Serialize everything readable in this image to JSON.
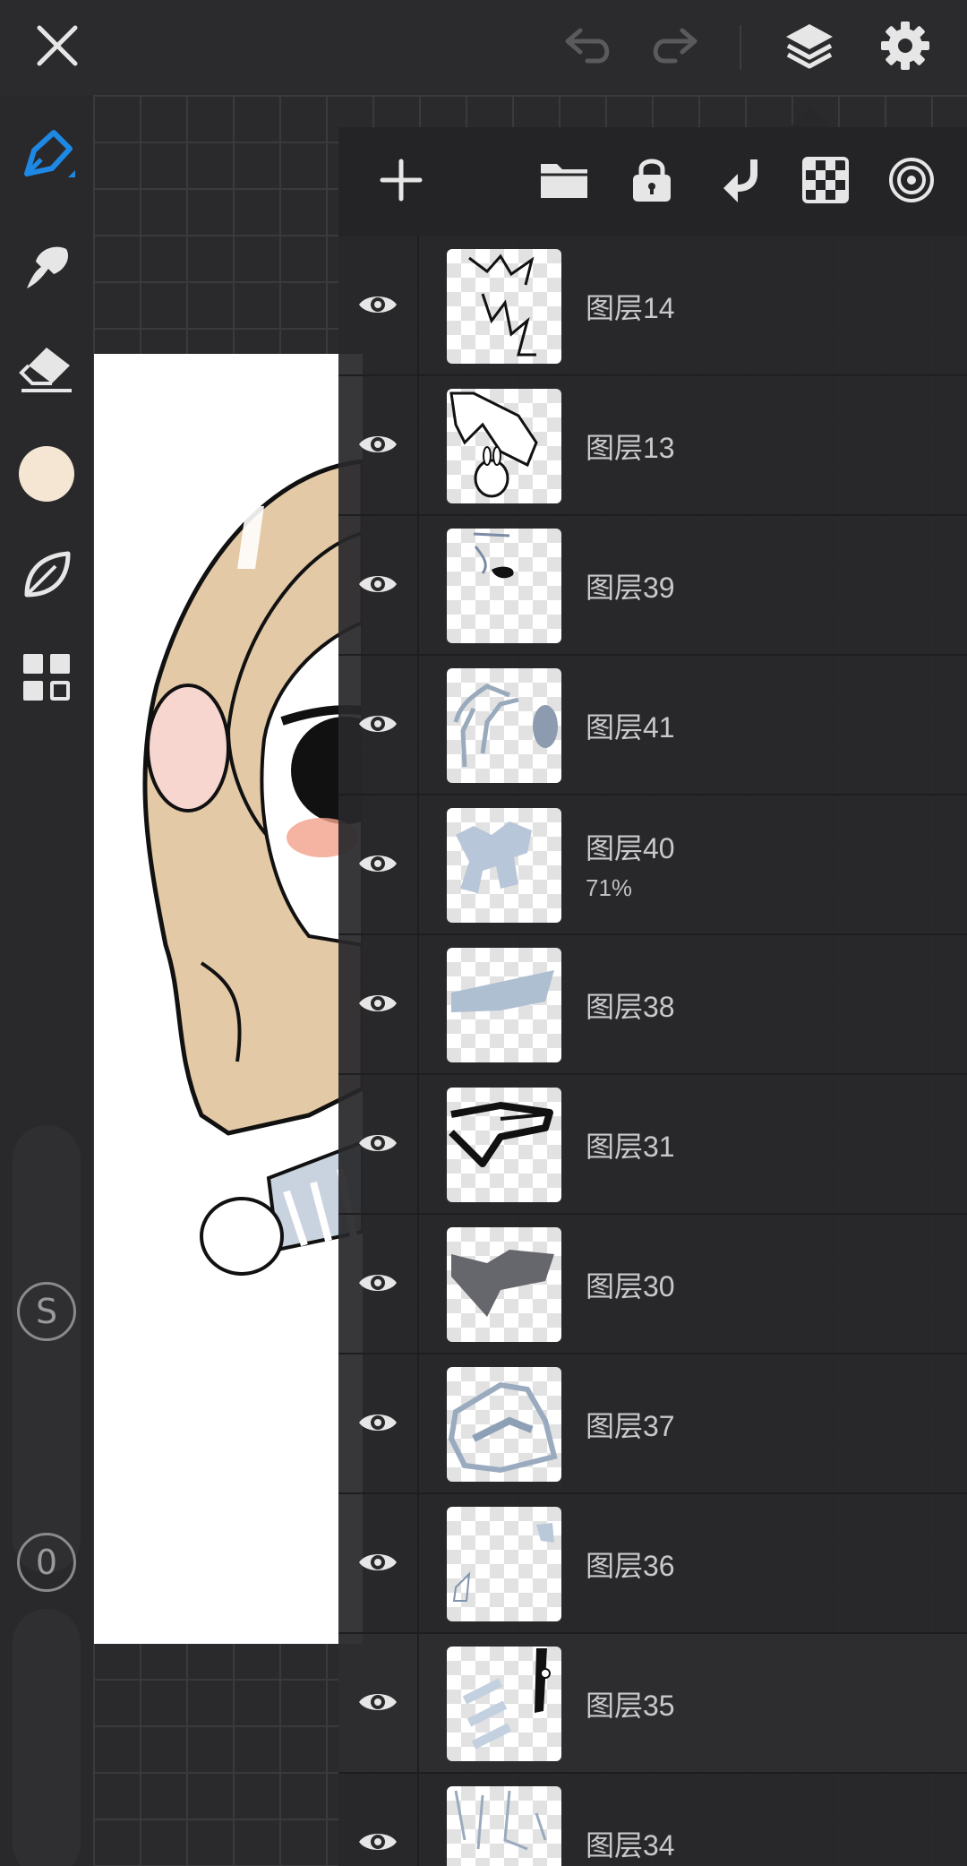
{
  "topbar": {
    "close_icon": "close-icon",
    "undo_icon": "undo-icon",
    "redo_icon": "redo-icon",
    "layers_icon": "layers-icon",
    "settings_icon": "gear-icon"
  },
  "toolbar": {
    "tools": [
      "pen-icon",
      "smudge-icon",
      "eraser-icon",
      "color-swatch",
      "leaf-icon",
      "grid-icon"
    ],
    "current_color": "#f5e6d3",
    "accent_color": "#1e88e5",
    "size_label": "S",
    "opacity_label": "0"
  },
  "panel": {
    "toolbar_icons": [
      "add-layer-icon",
      "folder-icon",
      "lock-icon",
      "merge-down-icon",
      "transparency-icon",
      "target-icon"
    ]
  },
  "layers": [
    {
      "name": "图层14",
      "opacity": ""
    },
    {
      "name": "图层13",
      "opacity": ""
    },
    {
      "name": "图层39",
      "opacity": ""
    },
    {
      "name": "图层41",
      "opacity": ""
    },
    {
      "name": "图层40",
      "opacity": "71%"
    },
    {
      "name": "图层38",
      "opacity": ""
    },
    {
      "name": "图层31",
      "opacity": ""
    },
    {
      "name": "图层30",
      "opacity": ""
    },
    {
      "name": "图层37",
      "opacity": ""
    },
    {
      "name": "图层36",
      "opacity": ""
    },
    {
      "name": "图层35",
      "opacity": ""
    },
    {
      "name": "图层34",
      "opacity": ""
    }
  ]
}
